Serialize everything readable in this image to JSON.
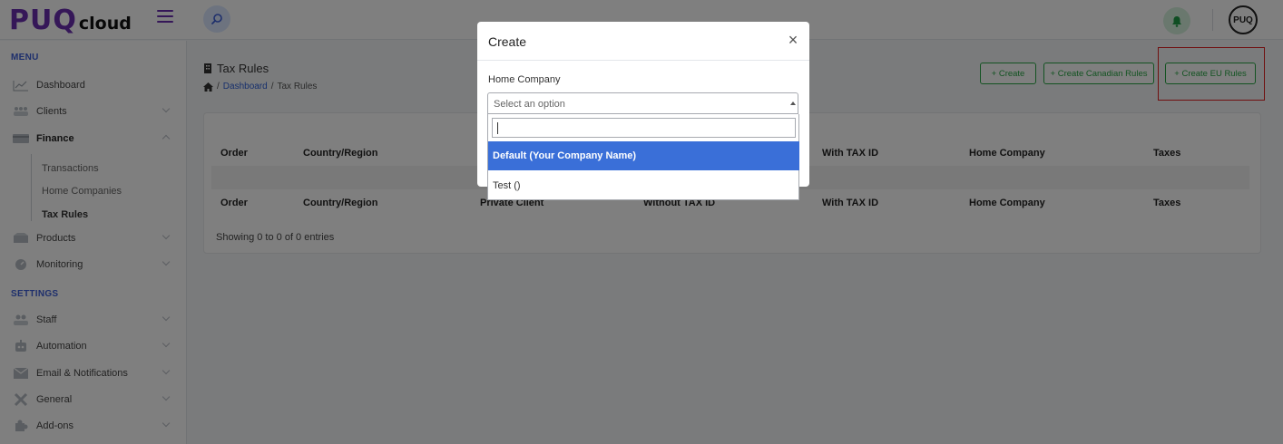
{
  "app": {
    "brand_main": "PUQ",
    "brand_sub": "cloud",
    "avatar_text": "PUQ"
  },
  "colors": {
    "brand": "#6b2fb0",
    "link": "#2d5fd8",
    "success": "#28a745",
    "selected_option": "#3a6fd8",
    "highlight": "#e02020"
  },
  "sidebar": {
    "menu_header": "MENU",
    "settings_header": "SETTINGS",
    "items": [
      {
        "label": "Dashboard",
        "icon": "chart-line-icon"
      },
      {
        "label": "Clients",
        "icon": "users-icon"
      },
      {
        "label": "Finance",
        "icon": "wallet-icon"
      },
      {
        "label": "Products",
        "icon": "box-icon"
      },
      {
        "label": "Monitoring",
        "icon": "gauge-icon"
      },
      {
        "label": "Staff",
        "icon": "staff-icon"
      },
      {
        "label": "Automation",
        "icon": "robot-icon"
      },
      {
        "label": "Email & Notifications",
        "icon": "email-icon"
      },
      {
        "label": "General",
        "icon": "tools-icon"
      },
      {
        "label": "Add-ons",
        "icon": "puzzle-icon"
      }
    ],
    "finance_sub": [
      "Transactions",
      "Home Companies",
      "Tax Rules"
    ]
  },
  "page": {
    "title": "Tax Rules",
    "breadcrumb_sep": "/",
    "breadcrumb_link": "Dashboard",
    "breadcrumb_current": "Tax Rules"
  },
  "actions": {
    "create": "+ Create",
    "create_canadian": "+ Create Canadian Rules",
    "create_eu": "+ Create EU Rules"
  },
  "table": {
    "columns": [
      "Order",
      "Country/Region",
      "Private Client",
      "Without TAX ID",
      "With TAX ID",
      "Home Company",
      "Taxes"
    ],
    "showing": "Showing 0 to 0 of 0 entries"
  },
  "modal": {
    "title": "Create",
    "close_glyph": "×",
    "field_label": "Home Company",
    "placeholder": "Select an option",
    "options": [
      "Default (Your Company Name)",
      "Test ()"
    ]
  }
}
